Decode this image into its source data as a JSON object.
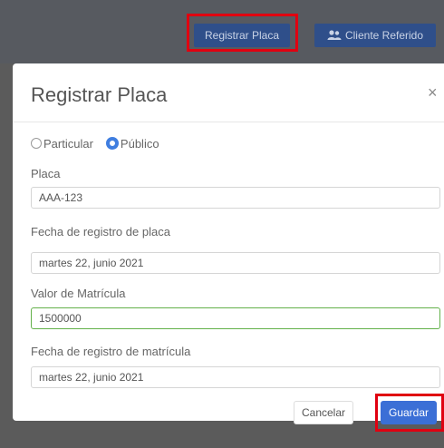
{
  "topbar": {
    "registrar_label": "Registrar Placa",
    "cliente_label": "Cliente Referido",
    "cliente_icon": "users-icon"
  },
  "modal": {
    "title": "Registrar Placa",
    "close_glyph": "×",
    "radios": [
      {
        "label": "Particular",
        "checked": false
      },
      {
        "label": "Público",
        "checked": true
      }
    ],
    "fields": {
      "placa": {
        "label": "Placa",
        "value": "AAA-123"
      },
      "fecha_placa": {
        "label": "Fecha de registro de placa",
        "value": "martes 22, junio 2021"
      },
      "valor_matricula": {
        "label": "Valor de Matrícula",
        "value": "1500000"
      },
      "fecha_matricula": {
        "label": "Fecha de registro de matrícula",
        "value": "martes 22, junio 2021"
      }
    },
    "cancel_label": "Cancelar",
    "save_label": "Guardar"
  },
  "colors": {
    "highlight": "#e00010",
    "primary": "#3b6fd6",
    "valid_border": "#63b14a"
  }
}
